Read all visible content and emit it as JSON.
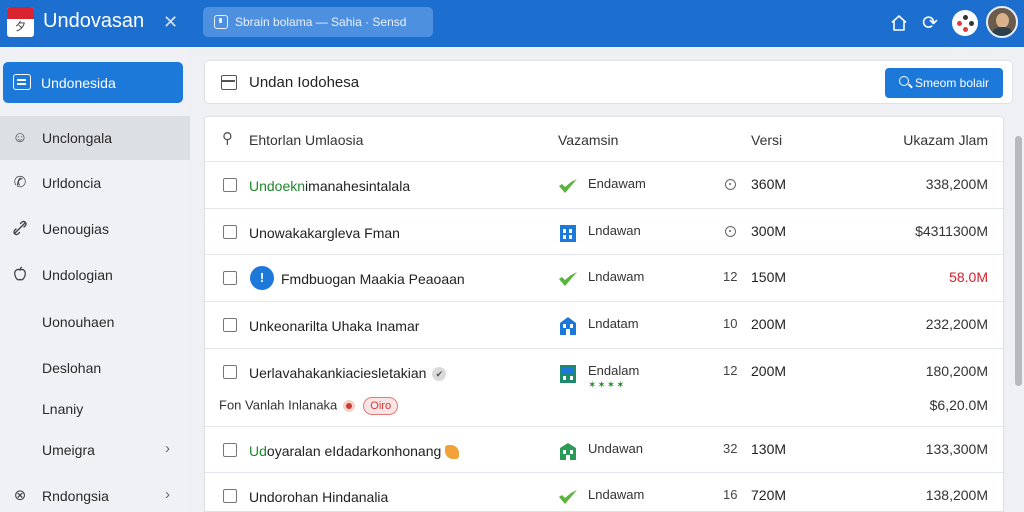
{
  "app": {
    "title": "Undovasan",
    "close_symbol": "✕",
    "logo_glyph": "夕"
  },
  "search": {
    "text": "Sbrain bolama  —  Sahia · Sensd"
  },
  "header": {
    "home_icon": "home-icon",
    "sync_icon": "sync-icon",
    "sync_symbol": "⟳",
    "apps_icon": "apps-icon",
    "avatar_icon": "user-avatar"
  },
  "sidebar": {
    "active": {
      "label": "Undonesida",
      "icon": "list-icon"
    },
    "items": [
      {
        "label": "Unclongala",
        "icon": "chat-icon",
        "symbol": "☺",
        "chevron": ""
      },
      {
        "label": "Urldoncia",
        "icon": "phone-icon",
        "symbol": "✆",
        "chevron": ""
      },
      {
        "label": "Uenougias",
        "icon": "link-icon",
        "symbol": "⛓",
        "chevron": ""
      },
      {
        "label": "Undologian",
        "icon": "apple-icon",
        "symbol": "",
        "chevron": ""
      },
      {
        "label": "Uonouhaen",
        "icon": "",
        "symbol": "",
        "chevron": ""
      },
      {
        "label": "Deslohan",
        "icon": "",
        "symbol": "",
        "chevron": ""
      },
      {
        "label": "Lnaniy",
        "icon": "",
        "symbol": "",
        "chevron": ""
      },
      {
        "label": "Umeigra",
        "icon": "",
        "symbol": "",
        "chevron": "›"
      },
      {
        "label": "Rndongsia",
        "icon": "close-circle-icon",
        "symbol": "⊗",
        "chevron": "›"
      }
    ]
  },
  "panel": {
    "title": "Undan Iodohesa",
    "button_label": "Smeom bolair",
    "button_icon": "search-icon",
    "header_icon": "archive-icon"
  },
  "table": {
    "columns": {
      "name": "Ehtorlan Umlaosia",
      "type": "Vazamsin",
      "version": "Versi",
      "total": "Ukazam Jlam"
    },
    "pin_icon": "pin-icon",
    "pin_symbol": "⚲",
    "rows": [
      {
        "name_green": "Undoekn",
        "name_rest": "imanahesintalala",
        "type_icon": "green-check-icon",
        "type_label": "Endawam",
        "version": "",
        "version_dot": true,
        "size": "360M",
        "total": "338,200M"
      },
      {
        "name_green": "",
        "name_rest": "Unowakakargleva Fman",
        "type_icon": "building-icon",
        "type_label": "Lndawan",
        "version": "",
        "version_dot": true,
        "size": "300M",
        "total": "$4311300M"
      },
      {
        "name_green": "",
        "name_rest": "Fmdbuogan Maakia Peaoaan",
        "lead_icon": "info-circle-icon",
        "lead_symbol": "!",
        "type_icon": "green-check-icon",
        "type_label": "Lndawam",
        "version": "12",
        "size": "150M",
        "total": "58.0M",
        "alert": true
      },
      {
        "name_green": "",
        "name_rest": "Unkeonarilta Uhaka Inamar",
        "type_icon": "building-icon",
        "type_label": "Lndatam",
        "version": "10",
        "size": "200M",
        "total": "232,200M"
      },
      {
        "name_green": "",
        "name_rest": "Uerlavahakankiaciesletakian",
        "trailing_check": "✔",
        "type_icon": "building-green-icon",
        "type_label": "Endalam",
        "type_sub": "✶✶✶✶",
        "version": "12",
        "size": "200M",
        "total": "180,200M",
        "sub_text": "Fon Vanlah Inlanaka",
        "sub_pill": "Oiro",
        "sub_total": "$6,20.0M"
      },
      {
        "name_green": "Ud",
        "name_rest": "oyaralan eIdadarkonhonang",
        "trailing_icon": "leaf-icon",
        "type_icon": "building-green-icon",
        "type_label": "Undawan",
        "version": "32",
        "size": "130M",
        "total": "133,300M"
      },
      {
        "name_green": "",
        "name_rest": "Undorohan Hindanalia",
        "type_icon": "green-check-icon",
        "type_label": "Lndawam",
        "version": "16",
        "size": "720M",
        "total": "138,200M"
      }
    ]
  },
  "colors": {
    "topbar": "#1c6fcf",
    "accent": "#1c78d9",
    "green": "#1d8a2a",
    "alert": "#d3202e"
  }
}
